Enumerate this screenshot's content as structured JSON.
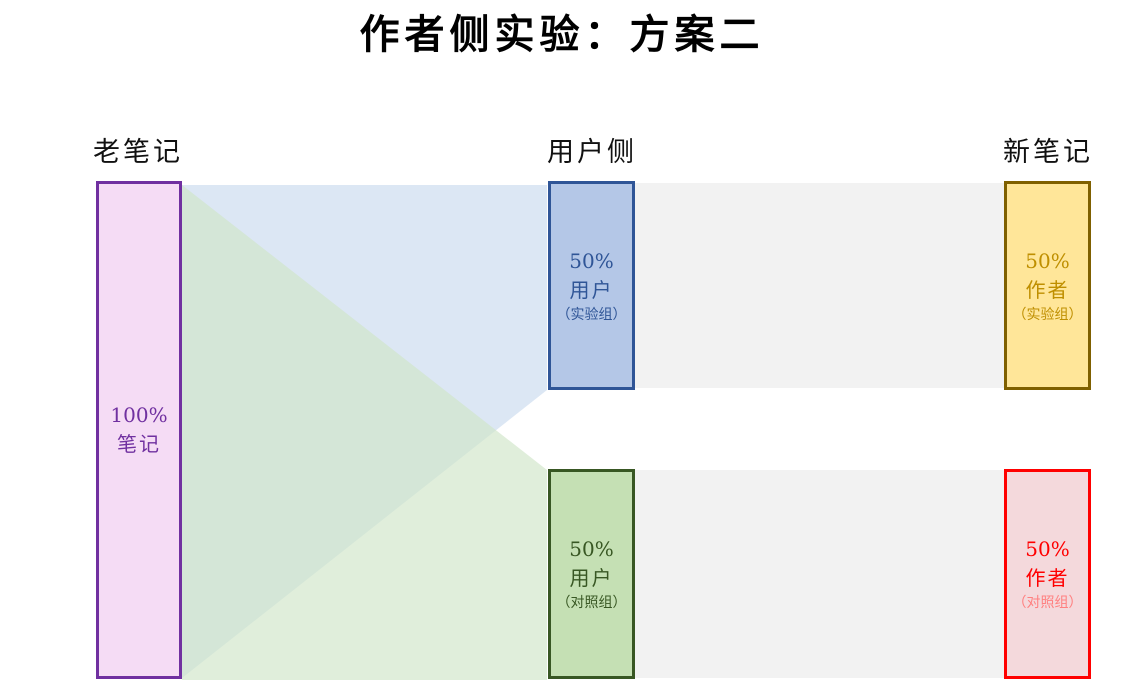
{
  "title": "作者侧实验：方案二",
  "columns": {
    "left": "老笔记",
    "middle": "用户侧",
    "right": "新笔记"
  },
  "nodes": {
    "old_notes": {
      "percent": "100%",
      "name": "笔记",
      "group": ""
    },
    "user_exp": {
      "percent": "50%",
      "name": "用户",
      "group": "（实验组）"
    },
    "user_ctrl": {
      "percent": "50%",
      "name": "用户",
      "group": "（对照组）"
    },
    "author_exp": {
      "percent": "50%",
      "name": "作者",
      "group": "（实验组）"
    },
    "author_ctrl": {
      "percent": "50%",
      "name": "作者",
      "group": "（对照组）"
    }
  },
  "colors": {
    "old_notes_fill": "#f5dcf5",
    "old_notes_border": "#7030a0",
    "old_notes_text": "#7030a0",
    "user_exp_fill": "#b4c7e7",
    "user_exp_border": "#2f5597",
    "user_exp_text": "#2f5597",
    "user_ctrl_fill": "#c5e0b4",
    "user_ctrl_border": "#385723",
    "user_ctrl_text": "#385723",
    "author_exp_fill": "#ffe699",
    "author_exp_border": "#7f6000",
    "author_exp_text": "#bf8f00",
    "author_ctrl_fill": "#f4d9dc",
    "author_ctrl_border": "#ff0000",
    "author_ctrl_text": "#ff0000",
    "flow_blue": "#dae6f3",
    "flow_green": "#d8ebd2",
    "flow_gray": "#f2f2f2"
  }
}
